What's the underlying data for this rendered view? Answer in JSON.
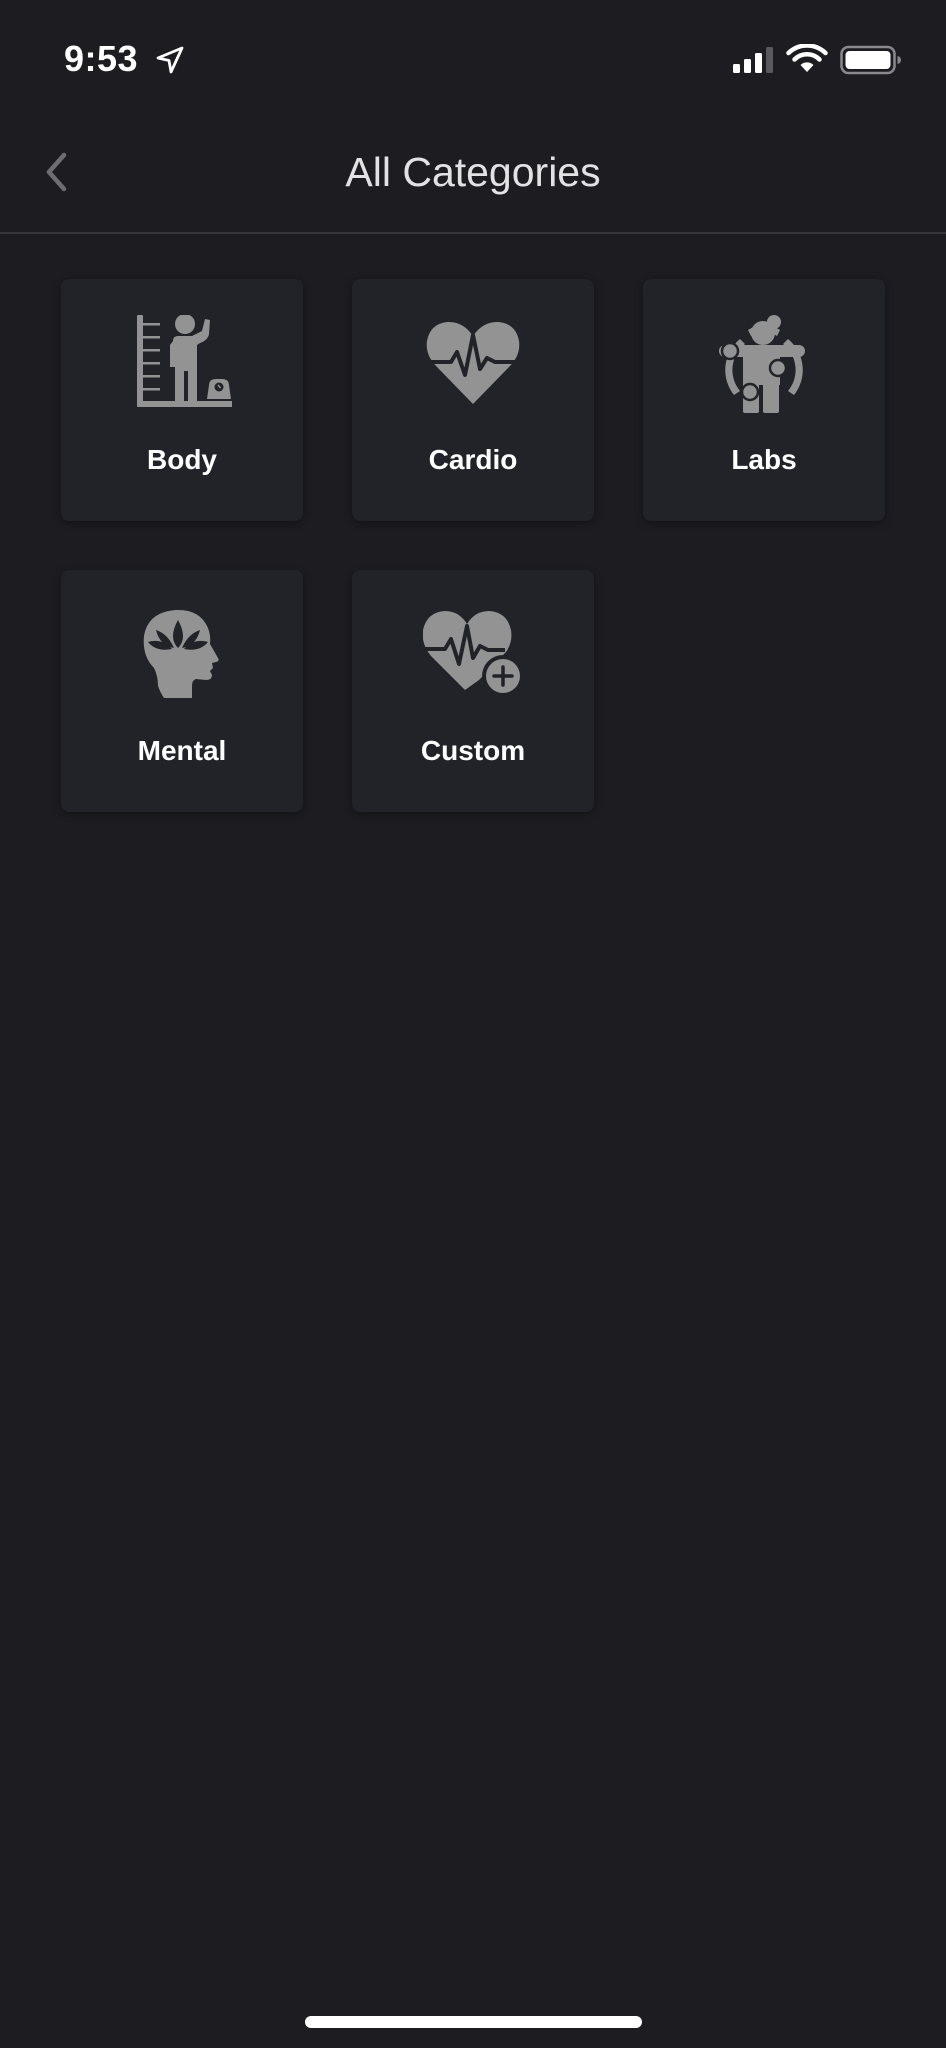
{
  "status_bar": {
    "time": "9:53",
    "location_icon": "location-arrow-icon",
    "signal_icon": "cellular-signal-icon",
    "wifi_icon": "wifi-icon",
    "battery_icon": "battery-icon"
  },
  "nav": {
    "back_icon": "chevron-left-icon",
    "title": "All Categories"
  },
  "categories": [
    {
      "label": "Body",
      "icon": "body-measurement-icon"
    },
    {
      "label": "Cardio",
      "icon": "heart-pulse-icon"
    },
    {
      "label": "Labs",
      "icon": "body-scan-icon"
    },
    {
      "label": "Mental",
      "icon": "mind-lotus-icon"
    },
    {
      "label": "Custom",
      "icon": "heart-plus-icon"
    }
  ],
  "colors": {
    "background": "#1c1c21",
    "card": "#212329",
    "icon": "#939393",
    "label": "#ffffff",
    "title": "#e2e2e4"
  }
}
